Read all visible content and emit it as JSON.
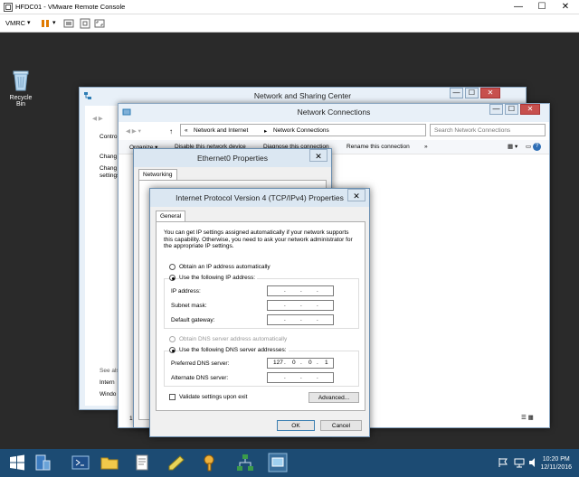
{
  "vmrc": {
    "title": "HFDC01 - VMware Remote Console",
    "menu_label": "VMRC",
    "menu_caret": "▾",
    "minimize": "—",
    "maximize": "☐",
    "close": "✕"
  },
  "desktop": {
    "recycle_bin_label": "Recycle Bin"
  },
  "nsc_window": {
    "title": "Network and Sharing Center",
    "left_items": [
      "Contro",
      "Chang",
      "Chang",
      "settings"
    ],
    "see_also": [
      "See als",
      "Intern",
      "Windo"
    ]
  },
  "nc_window": {
    "title": "Network Connections",
    "breadcrumb_prefix": "«",
    "breadcrumb_1": "Network and Internet",
    "breadcrumb_sep": "▸",
    "breadcrumb_2": "Network Connections",
    "search_placeholder": "Search Network Connections",
    "toolbar": [
      "Organize ▾",
      "Disable this network device",
      "Diagnose this connection",
      "Rename this connection",
      "»"
    ],
    "status": "1 item"
  },
  "eth_window": {
    "title": "Ethernet0 Properties",
    "tab": "Networking",
    "close": "✕"
  },
  "ipv4_dialog": {
    "title": "Internet Protocol Version 4 (TCP/IPv4) Properties",
    "close": "✕",
    "tab": "General",
    "description": "You can get IP settings assigned automatically if your network supports this capability. Otherwise, you need to ask your network administrator for the appropriate IP settings.",
    "opt_auto_ip": "Obtain an IP address automatically",
    "opt_manual_ip": "Use the following IP address:",
    "ip_label": "IP address:",
    "subnet_label": "Subnet mask:",
    "gateway_label": "Default gateway:",
    "opt_auto_dns": "Obtain DNS server address automatically",
    "opt_manual_dns": "Use the following DNS server addresses:",
    "preferred_dns_label": "Preferred DNS server:",
    "alternate_dns_label": "Alternate DNS server:",
    "preferred_dns": [
      "127",
      "0",
      "0",
      "1"
    ],
    "validate_label": "Validate settings upon exit",
    "advanced_button": "Advanced...",
    "ok_button": "OK",
    "cancel_button": "Cancel",
    "dot": "."
  },
  "taskbar": {
    "time": "10:20 PM",
    "date": "12/11/2016"
  }
}
